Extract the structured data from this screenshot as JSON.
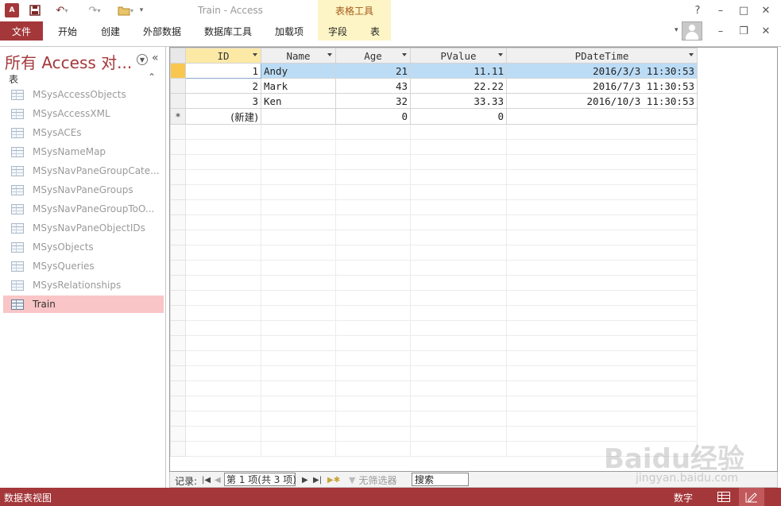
{
  "titlebar": {
    "app_icon_text": "A",
    "window_title": "Train - Access",
    "context_group": "表格工具",
    "help": "?",
    "minimize": "–",
    "restore": "□",
    "close": "✕"
  },
  "ribbon": {
    "tabs": [
      "文件",
      "开始",
      "创建",
      "外部数据",
      "数据库工具",
      "加载项",
      "字段",
      "表"
    ],
    "minimize_ribbon": "–",
    "restore_window": "❐",
    "close_db": "✕"
  },
  "nav": {
    "title": "所有 Access 对...",
    "collapse": "«",
    "group": "表",
    "group_collapse": "⌃",
    "items": [
      {
        "label": "MSysAccessObjects"
      },
      {
        "label": "MSysAccessXML"
      },
      {
        "label": "MSysACEs"
      },
      {
        "label": "MSysNameMap"
      },
      {
        "label": "MSysNavPaneGroupCate..."
      },
      {
        "label": "MSysNavPaneGroups"
      },
      {
        "label": "MSysNavPaneGroupToO..."
      },
      {
        "label": "MSysNavPaneObjectIDs"
      },
      {
        "label": "MSysObjects"
      },
      {
        "label": "MSysQueries"
      },
      {
        "label": "MSysRelationships"
      },
      {
        "label": "Train"
      }
    ],
    "selected_index": 11
  },
  "sheet": {
    "columns": [
      "ID",
      "Name",
      "Age",
      "PValue",
      "PDateTime"
    ],
    "rows": [
      {
        "ID": "1",
        "Name": "Andy",
        "Age": "21",
        "PValue": "11.11",
        "PDateTime": "2016/3/3 11:30:53"
      },
      {
        "ID": "2",
        "Name": "Mark",
        "Age": "43",
        "PValue": "22.22",
        "PDateTime": "2016/7/3 11:30:53"
      },
      {
        "ID": "3",
        "Name": "Ken",
        "Age": "32",
        "PValue": "33.33",
        "PDateTime": "2016/10/3 11:30:53"
      }
    ],
    "new_row": {
      "marker": "*",
      "ID": "(新建)",
      "Age": "0",
      "PValue": "0"
    }
  },
  "recnav": {
    "label": "记录:",
    "position": "第 1 项(共 3 项)",
    "filter_status": "无筛选器",
    "search": "搜索"
  },
  "statusbar": {
    "view_name": "数据表视图",
    "mode": "数字"
  },
  "watermark": {
    "main": "Baidu经验",
    "sub": "jingyan.baidu.com"
  },
  "colors": {
    "accent": "#a4373a",
    "selected_nav": "#f9c5c6",
    "current_row": "#bcdcf6",
    "context_tab": "#fdf5c6"
  }
}
